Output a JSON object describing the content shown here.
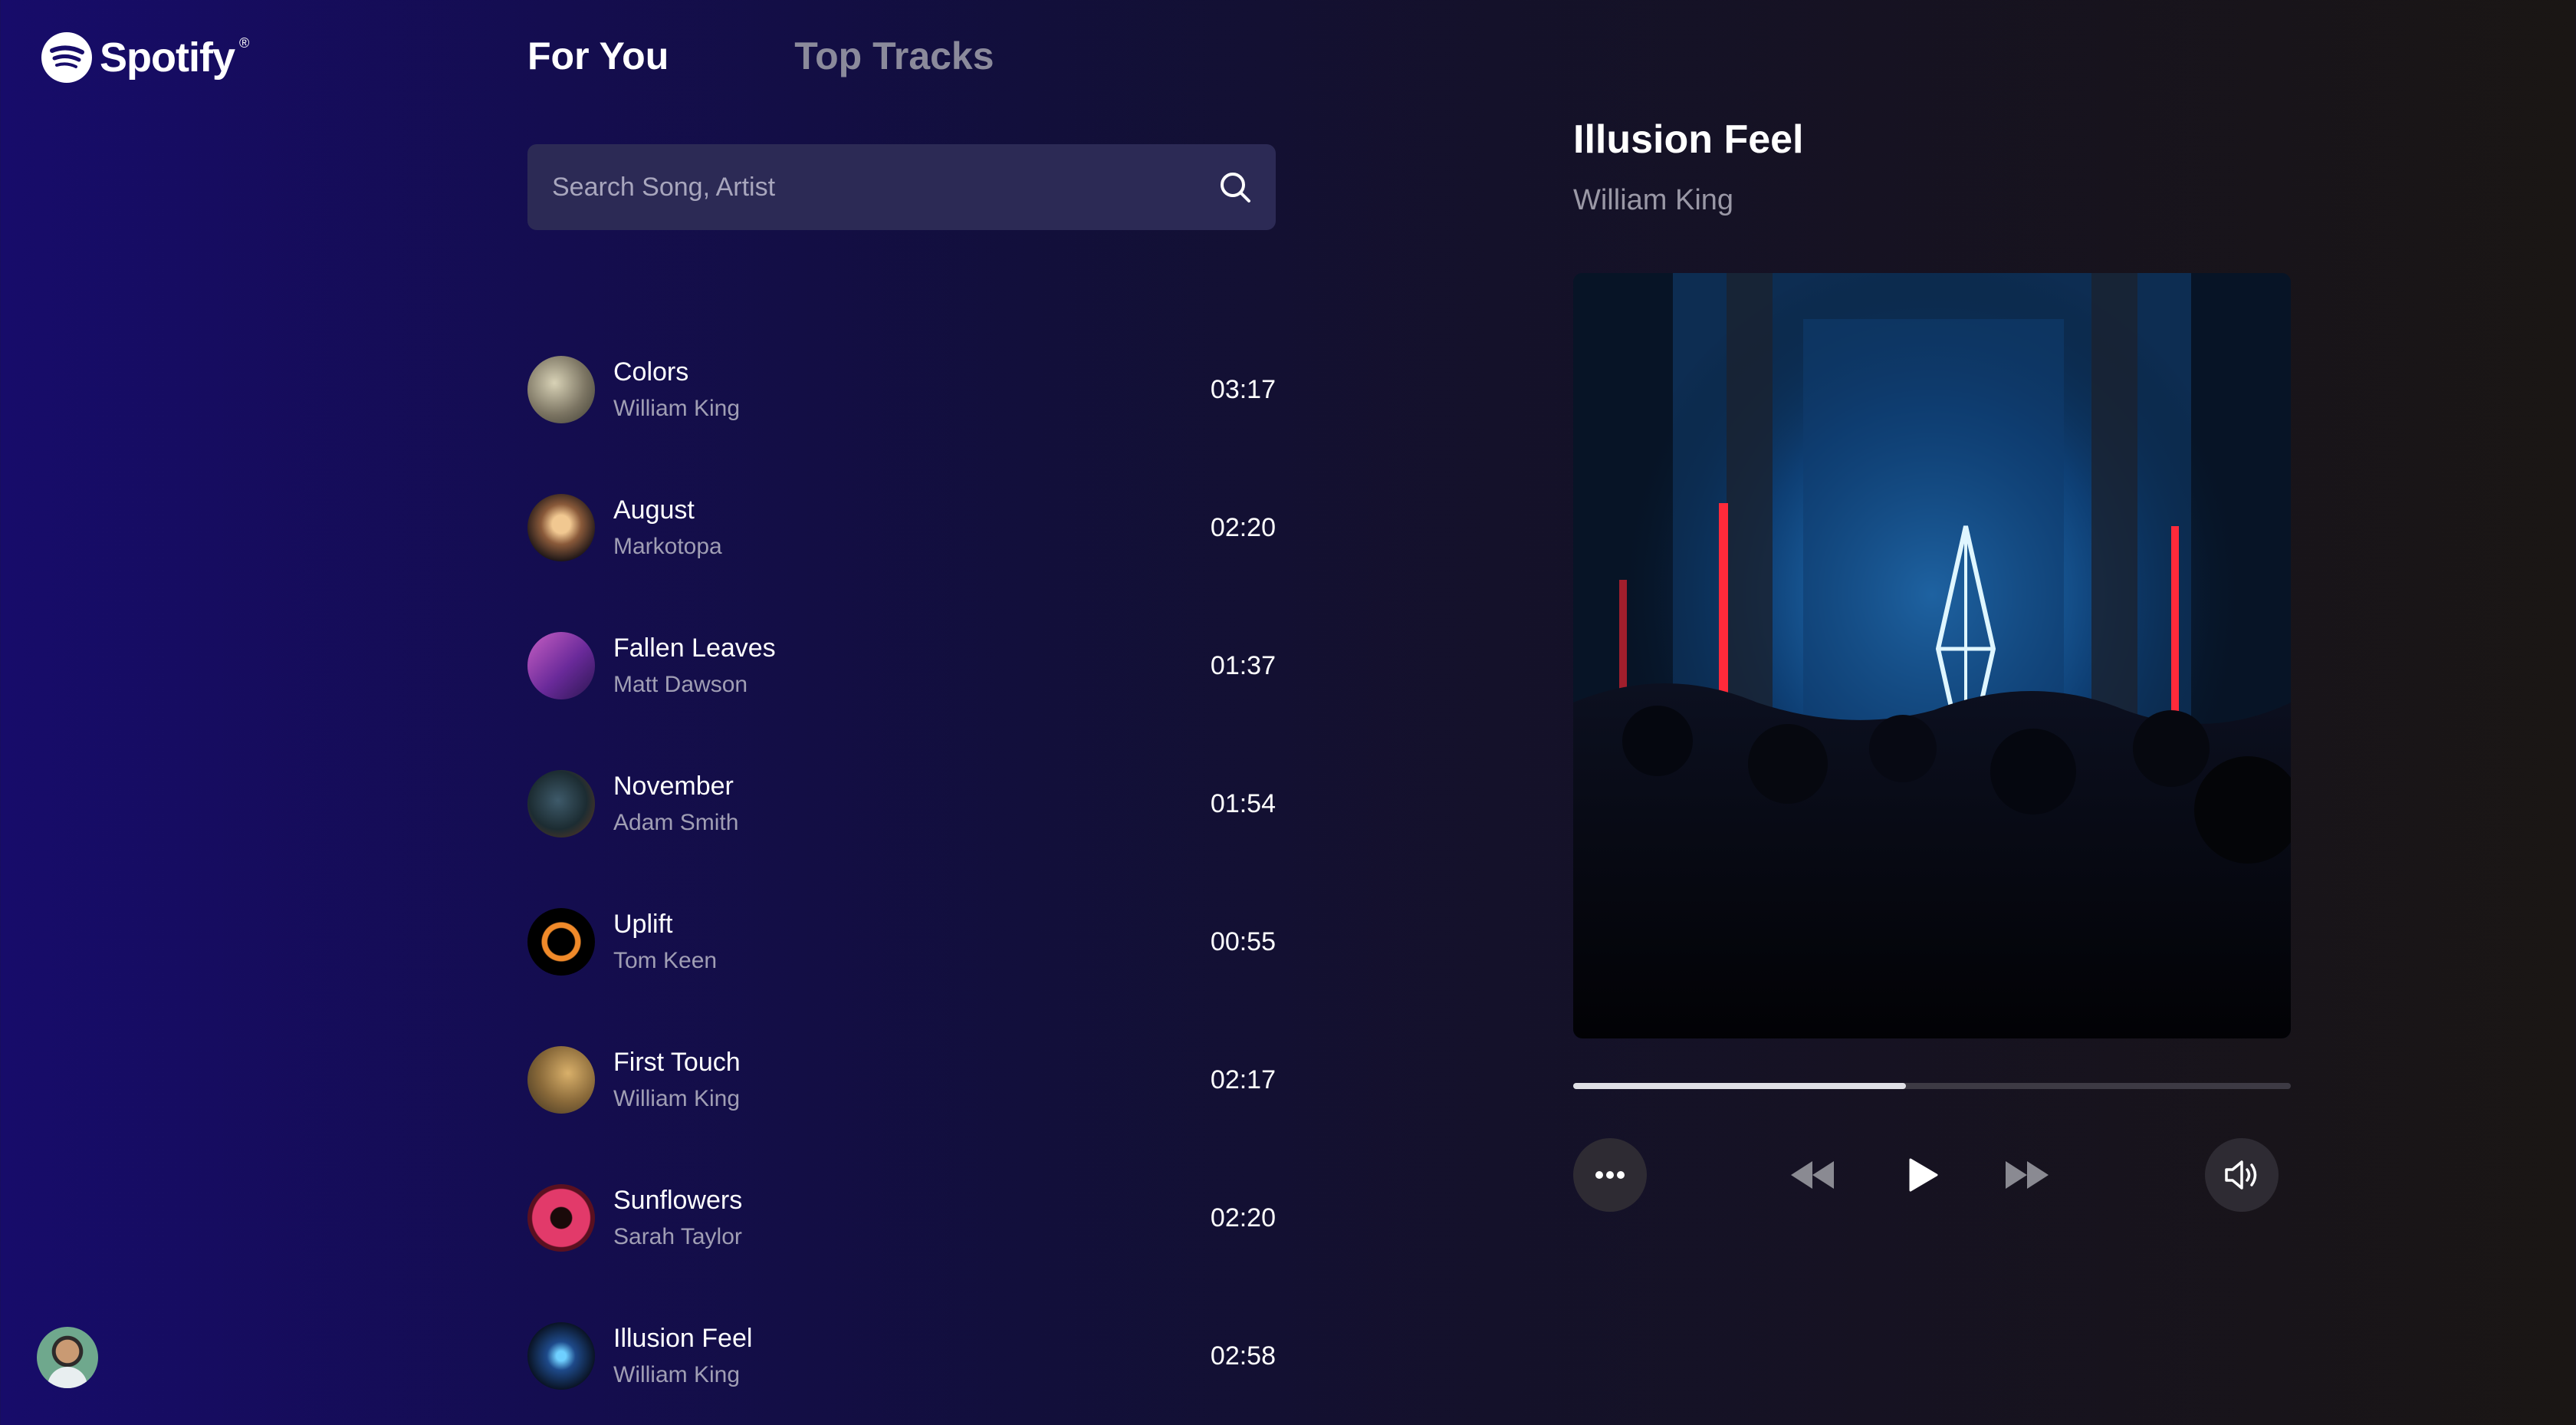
{
  "app": {
    "name": "Spotify",
    "reg": "®"
  },
  "tabs": [
    {
      "label": "For You",
      "active": true
    },
    {
      "label": "Top Tracks",
      "active": false
    }
  ],
  "search": {
    "placeholder": "Search Song, Artist",
    "value": ""
  },
  "tracks": [
    {
      "title": "Colors",
      "artist": "William King",
      "duration": "03:17"
    },
    {
      "title": "August",
      "artist": "Markotopa",
      "duration": "02:20"
    },
    {
      "title": "Fallen Leaves",
      "artist": "Matt Dawson",
      "duration": "01:37"
    },
    {
      "title": "November",
      "artist": "Adam Smith",
      "duration": "01:54"
    },
    {
      "title": "Uplift",
      "artist": "Tom Keen",
      "duration": "00:55"
    },
    {
      "title": "First Touch",
      "artist": "William King",
      "duration": "02:17"
    },
    {
      "title": "Sunflowers",
      "artist": "Sarah Taylor",
      "duration": "02:20"
    },
    {
      "title": "Illusion Feel",
      "artist": "William King",
      "duration": "02:58"
    }
  ],
  "now_playing": {
    "title": "Illusion Feel",
    "artist": "William King",
    "progress": 0.464
  },
  "controls": [
    "more-icon",
    "rewind-icon",
    "play-icon",
    "fast-forward-icon",
    "volume-icon"
  ],
  "colors": {
    "accent": "#ffffff",
    "background_left": "#170c6a",
    "background_right": "#1a1614"
  }
}
